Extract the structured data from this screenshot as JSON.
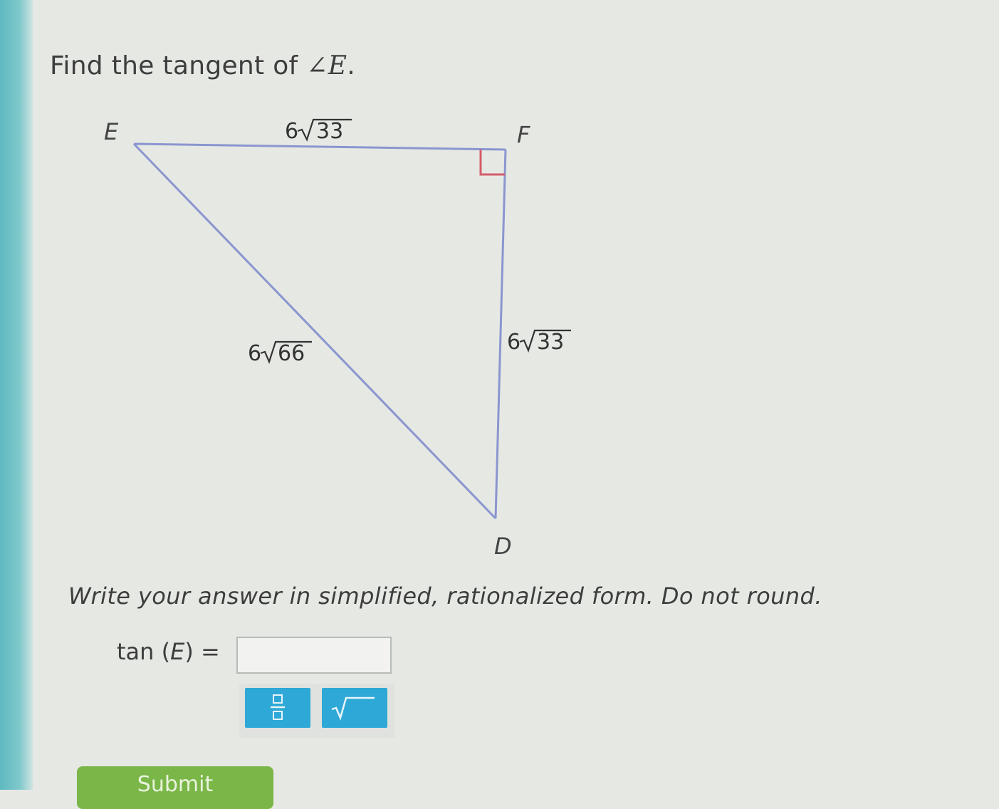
{
  "question": {
    "prompt_prefix": "Find the tangent of",
    "prompt_angle": "∠E",
    "prompt_suffix": "."
  },
  "figure": {
    "vertices": {
      "e": "E",
      "f": "F",
      "d": "D"
    },
    "sides": {
      "ef": {
        "coefficient": "6",
        "radicand": "33"
      },
      "fd": {
        "coefficient": "6",
        "radicand": "33"
      },
      "ed": {
        "coefficient": "6",
        "radicand": "66"
      }
    },
    "colors": {
      "triangle": "#8a96cf",
      "right_angle_marker": "#d45c6a"
    }
  },
  "instructions": "Write your answer in simplified, rationalized form. Do not round.",
  "answer": {
    "lhs_func": "tan",
    "lhs_open": "(",
    "lhs_var": "E",
    "lhs_close": ")",
    "equals": "=",
    "value": ""
  },
  "toolbar": {
    "buttons": [
      {
        "name": "fraction-button",
        "icon": "fraction-icon"
      },
      {
        "name": "sqrt-button",
        "icon": "sqrt-icon"
      }
    ],
    "color": "#2ea8d6"
  },
  "submit": {
    "label": "Submit",
    "color": "#7ab648"
  }
}
